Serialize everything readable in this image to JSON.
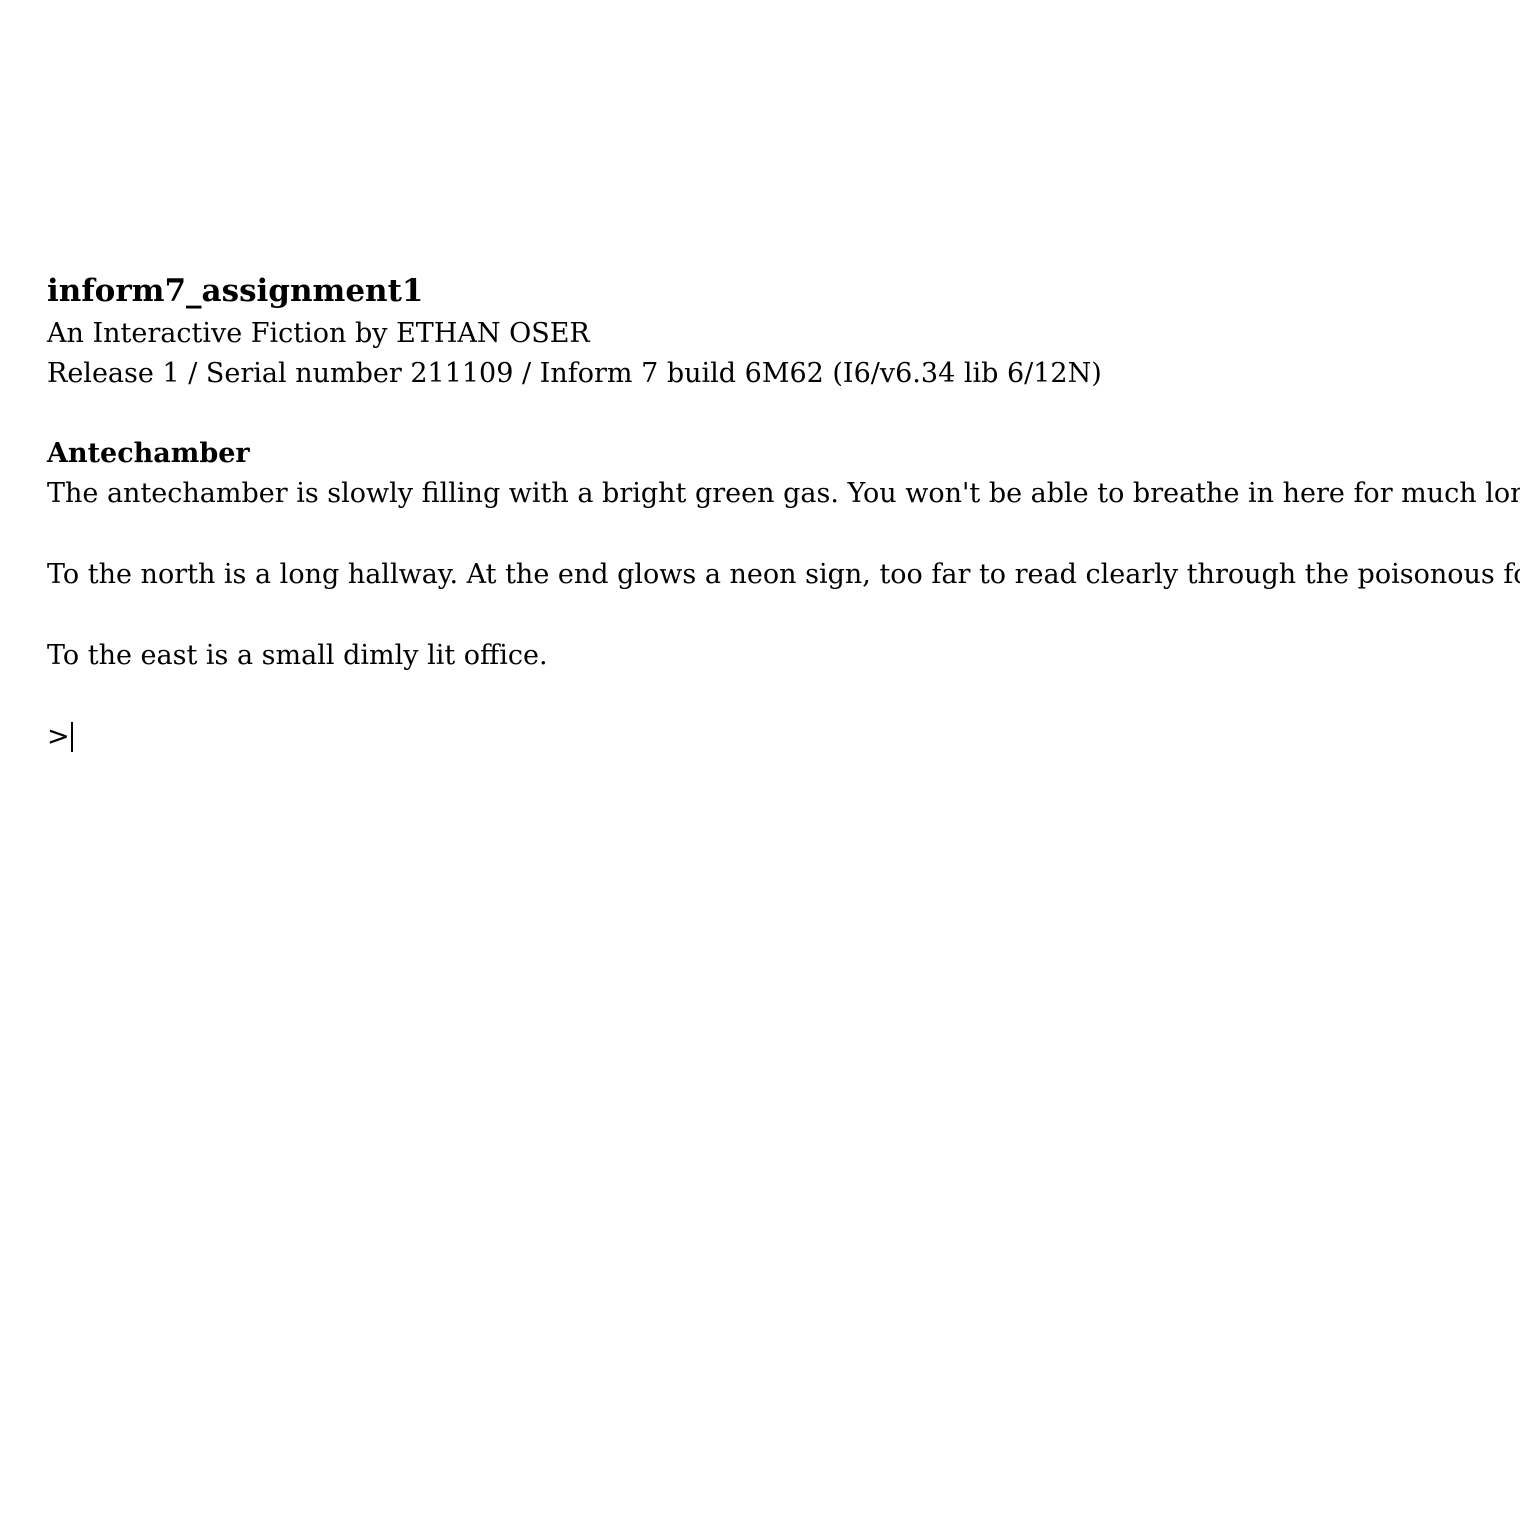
{
  "header": {
    "title": "inform7_assignment1",
    "byline": "An Interactive Fiction by ETHAN OSER",
    "release_info": "Release 1 / Serial number 211109 / Inform 7 build 6M62 (I6/v6.34 lib 6/12N)"
  },
  "room": {
    "name": "Antechamber",
    "paragraphs": [
      "The antechamber is slowly filling with a bright green gas. You won't be able to breathe in here for much longer.",
      "To the north is a long hallway. At the end glows a neon sign, too far to read clearly through the poisonous fog.",
      "To the east is a small dimly lit office."
    ]
  },
  "command_line": {
    "prompt": ">",
    "value": ""
  }
}
